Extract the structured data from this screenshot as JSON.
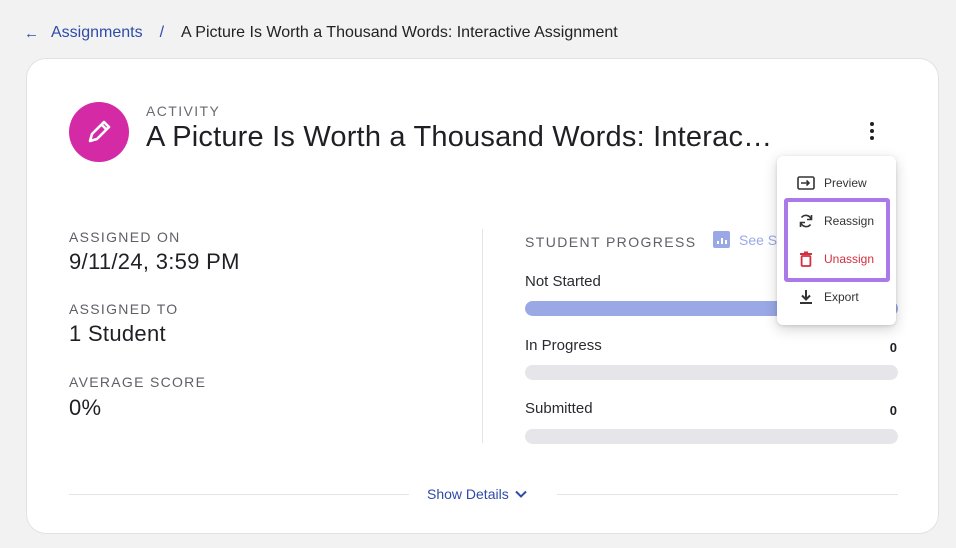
{
  "breadcrumb": {
    "back_icon": "arrow-left-icon",
    "root": "Assignments",
    "separator": "/",
    "current": "A Picture Is Worth a Thousand Words: Interactive Assignment"
  },
  "activity": {
    "icon": "pencil-icon",
    "kicker": "ACTIVITY",
    "title": "A Picture Is Worth a Thousand Words: Interac…",
    "icon_color": "#d42aa6"
  },
  "stats": [
    {
      "label": "ASSIGNED ON",
      "value": "9/11/24, 3:59 PM"
    },
    {
      "label": "ASSIGNED TO",
      "value": "1 Student"
    },
    {
      "label": "AVERAGE SCORE",
      "value": "0%"
    }
  ],
  "progress": {
    "heading": "STUDENT PROGRESS",
    "see_link": "See S",
    "rows": [
      {
        "label": "Not Started",
        "count": "",
        "fill": 1
      },
      {
        "label": "In Progress",
        "count": "0",
        "fill": 0
      },
      {
        "label": "Submitted",
        "count": "0",
        "fill": 0
      }
    ]
  },
  "footer": {
    "show_details": "Show Details"
  },
  "menu": {
    "items": [
      {
        "label": "Preview",
        "icon": "preview-icon"
      },
      {
        "label": "Reassign",
        "icon": "refresh-icon"
      },
      {
        "label": "Unassign",
        "icon": "trash-icon",
        "color": "#d32f3f"
      },
      {
        "label": "Export",
        "icon": "download-icon"
      }
    ],
    "highlight_color": "#a97ae8"
  },
  "colors": {
    "link": "#2f4ba8",
    "bar_fill": "#9aa9e6",
    "bar_track": "#e6e6ea"
  }
}
